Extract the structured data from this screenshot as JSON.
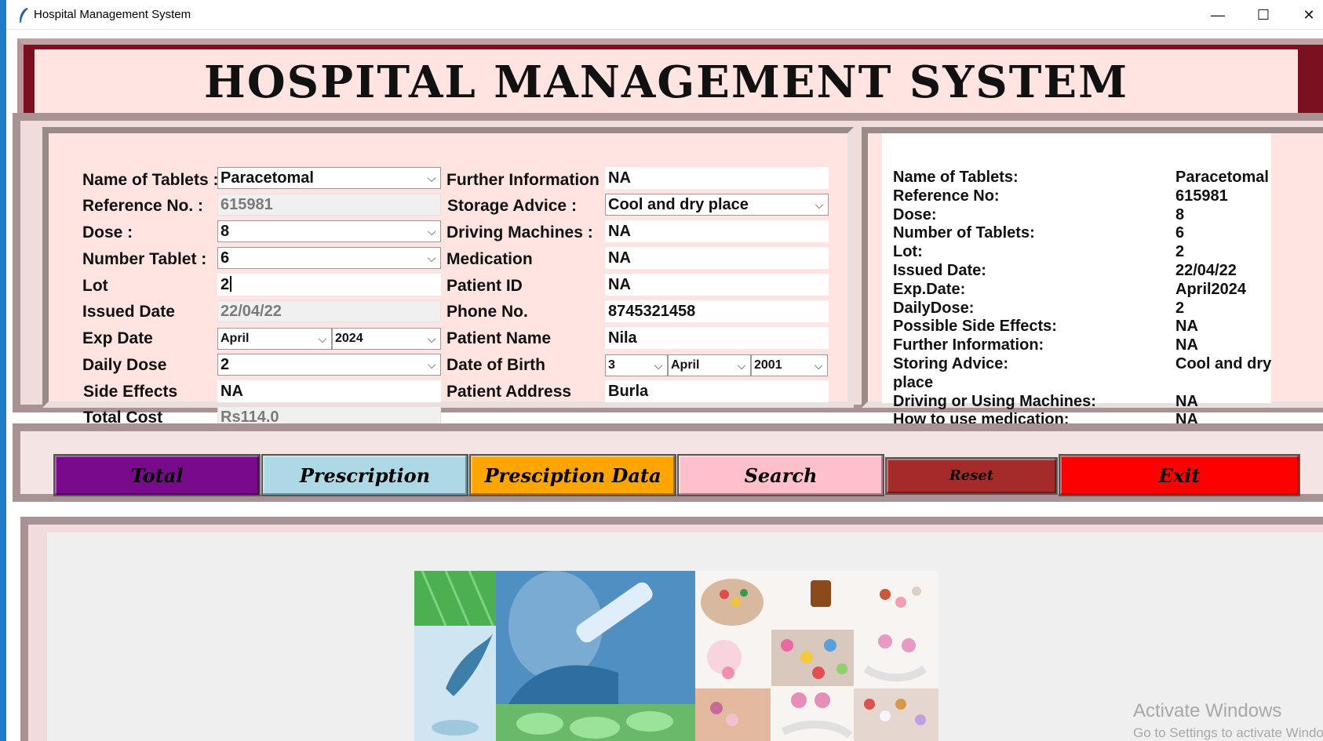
{
  "window": {
    "title": "Hospital Management System",
    "minimize": "—",
    "maximize": "☐",
    "close": "✕"
  },
  "header": {
    "title": "HOSPITAL MANAGEMENT SYSTEM"
  },
  "form": {
    "left": {
      "name_of_tablets": {
        "label": "Name of Tablets :",
        "value": "Paracetomal"
      },
      "reference_no": {
        "label": "Reference No. :",
        "value": "615981"
      },
      "dose": {
        "label": "Dose :",
        "value": "8"
      },
      "number_tablet": {
        "label": "Number Tablet :",
        "value": "6"
      },
      "lot": {
        "label": "Lot",
        "value": "2"
      },
      "issued_date": {
        "label": "Issued Date",
        "value": "22/04/22"
      },
      "exp_date": {
        "label": "Exp Date",
        "month": "April",
        "year": "2024"
      },
      "daily_dose": {
        "label": "Daily Dose",
        "value": "2"
      },
      "side_effects": {
        "label": "Side Effects",
        "value": "NA"
      },
      "total_cost": {
        "label": "Total Cost",
        "value": "Rs114.0"
      }
    },
    "right": {
      "further_information": {
        "label": "Further Information :",
        "value": "NA"
      },
      "storage_advice": {
        "label": "Storage Advice :",
        "value": "Cool and dry place"
      },
      "driving_machines": {
        "label": "Driving Machines :",
        "value": "NA"
      },
      "medication": {
        "label": "Medication",
        "value": "NA"
      },
      "patient_id": {
        "label": "Patient ID",
        "value": "NA"
      },
      "phone_no": {
        "label": "Phone No.",
        "value": "8745321458"
      },
      "patient_name": {
        "label": "Patient Name",
        "value": "Nila"
      },
      "date_of_birth": {
        "label": "Date of Birth",
        "day": "3",
        "month": "April",
        "year": "2001"
      },
      "patient_address": {
        "label": "Patient Address",
        "value": "Burla"
      }
    }
  },
  "prescription_panel": {
    "rows": [
      {
        "label": "Name of Tablets:",
        "value": "Paracetomal"
      },
      {
        "label": "Reference No:",
        "value": "615981"
      },
      {
        "label": "Dose:",
        "value": "8"
      },
      {
        "label": "Number of Tablets:",
        "value": "6"
      },
      {
        "label": "Lot:",
        "value": "2"
      },
      {
        "label": "Issued Date:",
        "value": "22/04/22"
      },
      {
        "label": "Exp.Date:",
        "value": "April2024"
      },
      {
        "label": "DailyDose:",
        "value": "2"
      },
      {
        "label": "Possible Side Effects:",
        "value": "NA"
      },
      {
        "label": "Further Information:",
        "value": "NA"
      },
      {
        "label": "Storing Advice:",
        "value": "Cool and dry"
      },
      {
        "label": "place",
        "value": ""
      },
      {
        "label": "Driving or Using Machines:",
        "value": "NA"
      },
      {
        "label": "How to use medication:",
        "value": "NA"
      }
    ]
  },
  "buttons": {
    "total": "Total",
    "prescription": "Prescription",
    "prescription_data": "Presciption Data",
    "search": "Search",
    "reset": "Reset",
    "exit": "Exit"
  },
  "colors": {
    "total": "#7a0a8c",
    "prescription": "#add8e6",
    "prescription_data": "#ffa500",
    "search": "#ffc0cb",
    "reset": "#a52a2a",
    "exit": "#ff0000",
    "header_bg": "#7a1020",
    "panel_bg": "#ffe4e1"
  },
  "watermark": {
    "line1": "Activate Windows",
    "line2": "Go to Settings to activate Windows."
  }
}
